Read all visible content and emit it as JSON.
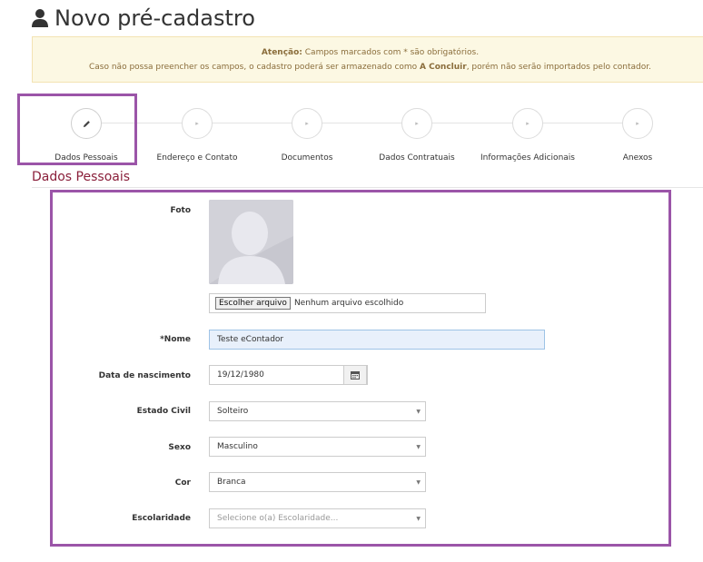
{
  "page": {
    "title": "Novo pré-cadastro",
    "icon": "user-icon"
  },
  "alert": {
    "strong": "Atenção:",
    "line1_rest": " Campos marcados com * são obrigatórios.",
    "line2_pre": "Caso não possa preencher os campos, o cadastro poderá ser armazenado como ",
    "line2_strong": "A Concluir",
    "line2_post": ", porém não serão importados pelo contador."
  },
  "wizard": {
    "steps": [
      {
        "label": "Dados Pessoais",
        "active": true,
        "icon": "pencil-icon"
      },
      {
        "label": "Endereço e Contato",
        "active": false,
        "icon": "chevron-right-icon"
      },
      {
        "label": "Documentos",
        "active": false,
        "icon": "chevron-right-icon"
      },
      {
        "label": "Dados Contratuais",
        "active": false,
        "icon": "chevron-right-icon"
      },
      {
        "label": "Informações Adicionais",
        "active": false,
        "icon": "chevron-right-icon"
      },
      {
        "label": "Anexos",
        "active": false,
        "icon": "chevron-right-icon"
      }
    ]
  },
  "section": {
    "title": "Dados Pessoais"
  },
  "form": {
    "foto": {
      "label": "Foto",
      "file_button": "Escolher arquivo",
      "file_status": "Nenhum arquivo escolhido"
    },
    "nome": {
      "label": "*Nome",
      "value": "Teste eContador"
    },
    "nascimento": {
      "label": "Data de nascimento",
      "value": "19/12/1980"
    },
    "estado_civil": {
      "label": "Estado Civil",
      "value": "Solteiro"
    },
    "sexo": {
      "label": "Sexo",
      "value": "Masculino"
    },
    "cor": {
      "label": "Cor",
      "value": "Branca"
    },
    "escolaridade": {
      "label": "Escolaridade",
      "value": "",
      "placeholder": "Selecione o(a) Escolaridade..."
    }
  },
  "colors": {
    "highlight": "#9b55a8",
    "section_title": "#8a1f3a",
    "alert_bg": "#fcf8e3",
    "alert_text": "#8a6d3b"
  }
}
